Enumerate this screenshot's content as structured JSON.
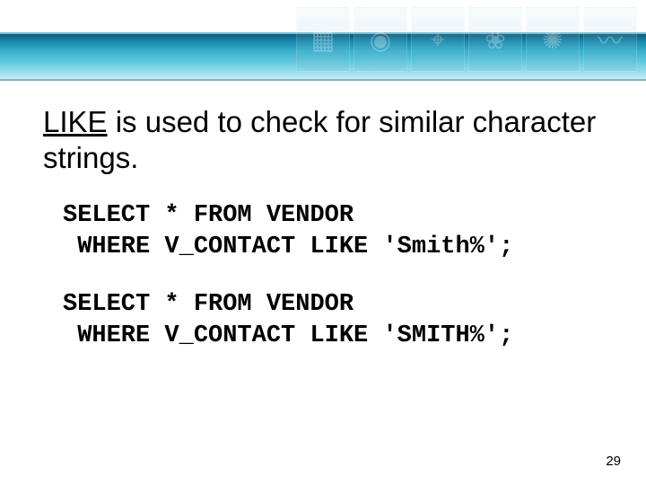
{
  "heading": {
    "keyword": "LIKE",
    "rest": " is used to check for similar character strings."
  },
  "code1": "SELECT * FROM VENDOR\n WHERE V_CONTACT LIKE 'Smith%';",
  "code2": "SELECT * FROM VENDOR\n WHERE V_CONTACT LIKE 'SMITH%';",
  "page_number": "29",
  "icons": {
    "i1": "▦",
    "i2": "◉",
    "i3": "⌖",
    "i4": "❀",
    "i5": "✺",
    "i6": "〰"
  }
}
